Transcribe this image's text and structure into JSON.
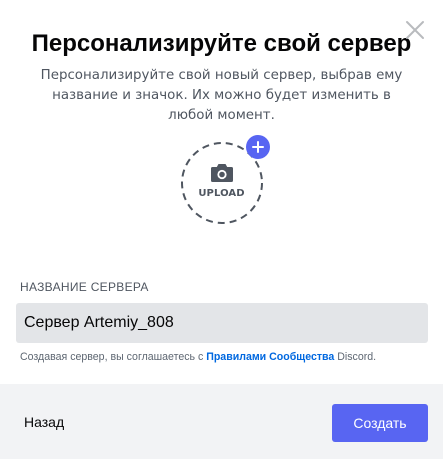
{
  "modal": {
    "title": "Персонализируйте свой сервер",
    "subtitle": "Персонализируйте свой новый сервер, выбрав ему название и значок. Их можно будет изменить в любой момент."
  },
  "upload": {
    "label": "UPLOAD",
    "camera_icon": "camera-icon",
    "plus_icon": "plus-icon"
  },
  "server_name": {
    "label": "НАЗВАНИЕ СЕРВЕРА",
    "value": "Сервер Artemiy_808"
  },
  "terms": {
    "prefix": "Создавая сервер, вы соглашаетесь с ",
    "link": "Правилами Сообщества",
    "suffix": " Discord."
  },
  "footer": {
    "back_label": "Назад",
    "create_label": "Создать"
  },
  "colors": {
    "accent": "#5865f2",
    "link": "#0068e0",
    "input_bg": "#e3e5e8",
    "footer_bg": "#f2f3f5"
  }
}
